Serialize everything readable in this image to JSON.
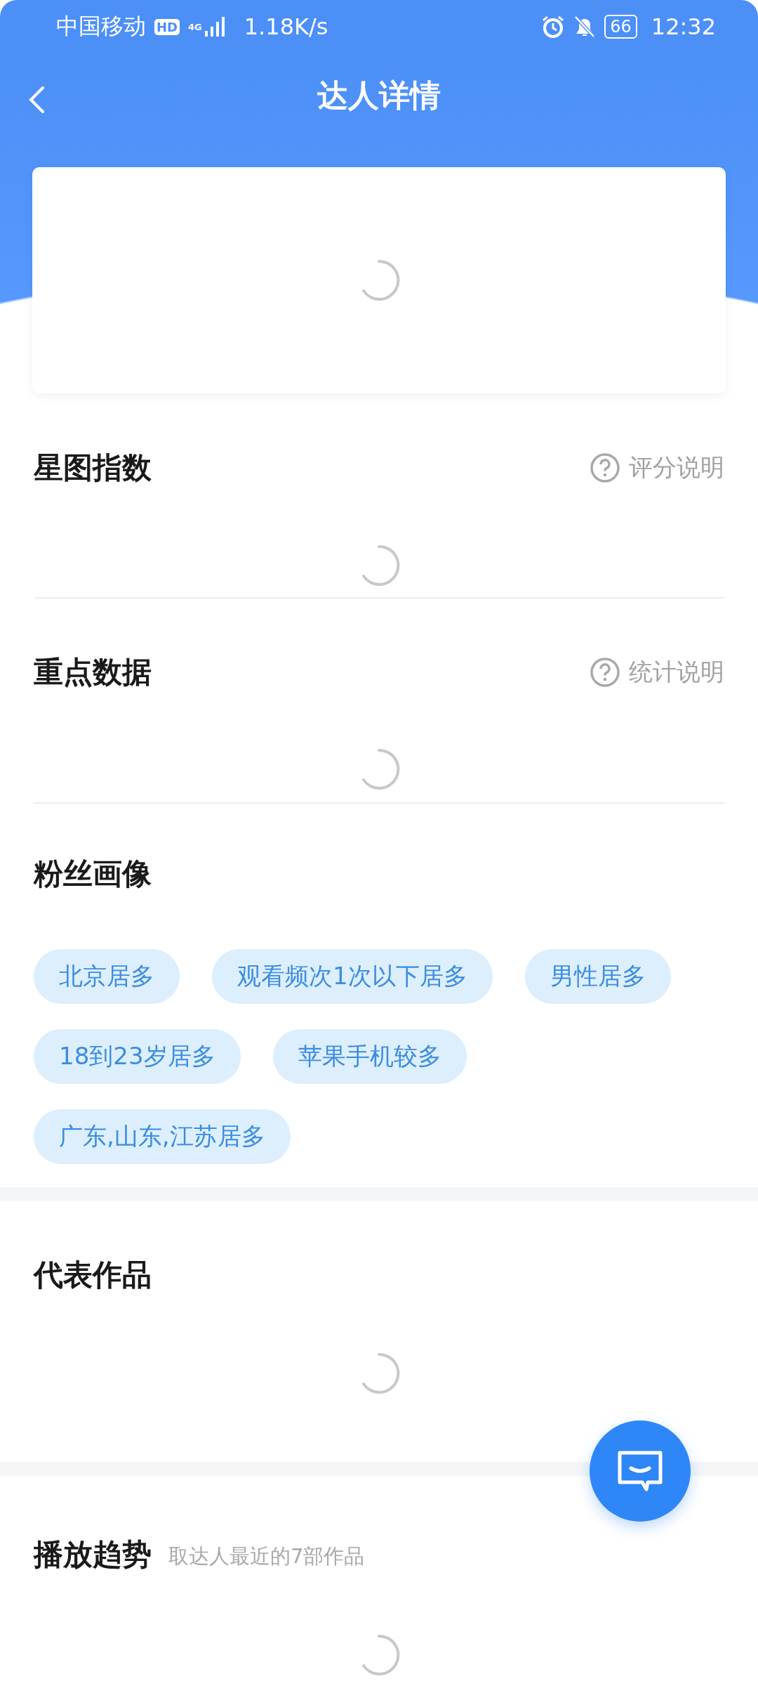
{
  "status_bar": {
    "carrier": "中国移动",
    "hd": "HD",
    "network": "4G",
    "speed": "1.18K/s",
    "battery": "66",
    "time": "12:32"
  },
  "header": {
    "title": "达人详情"
  },
  "profile_card": {
    "loading": true
  },
  "sections": [
    {
      "title": "星图指数",
      "link": "评分说明",
      "loading": true,
      "kind": "rule"
    },
    {
      "title": "重点数据",
      "link": "统计说明",
      "loading": true,
      "kind": "rule"
    },
    {
      "title": "粉丝画像",
      "tags": [
        "北京居多",
        "观看频次1次以下居多",
        "男性居多",
        "18到23岁居多",
        "苹果手机较多",
        "广东,山东,江苏居多"
      ],
      "kind": "band"
    },
    {
      "title": "代表作品",
      "loading": true,
      "kind": "band"
    },
    {
      "title": "播放趋势",
      "subtitle": "取达人最近的7部作品",
      "loading": true
    }
  ]
}
